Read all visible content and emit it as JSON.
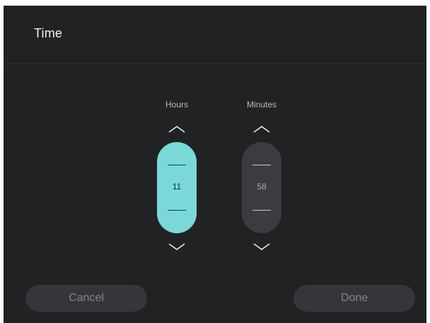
{
  "dialog": {
    "title": "Time"
  },
  "hours": {
    "label": "Hours",
    "value": "11",
    "state": "active",
    "up_icon": "chevron-up-icon",
    "down_icon": "chevron-down-icon"
  },
  "minutes": {
    "label": "Minutes",
    "value": "58",
    "state": "inactive",
    "up_icon": "chevron-up-icon",
    "down_icon": "chevron-down-icon"
  },
  "buttons": {
    "cancel_label": "Cancel",
    "done_label": "Done"
  },
  "colors": {
    "background": "#212224",
    "accent": "#7ad9d8",
    "inactive_stepper": "#3b3c3f",
    "button_background": "#35363a"
  }
}
